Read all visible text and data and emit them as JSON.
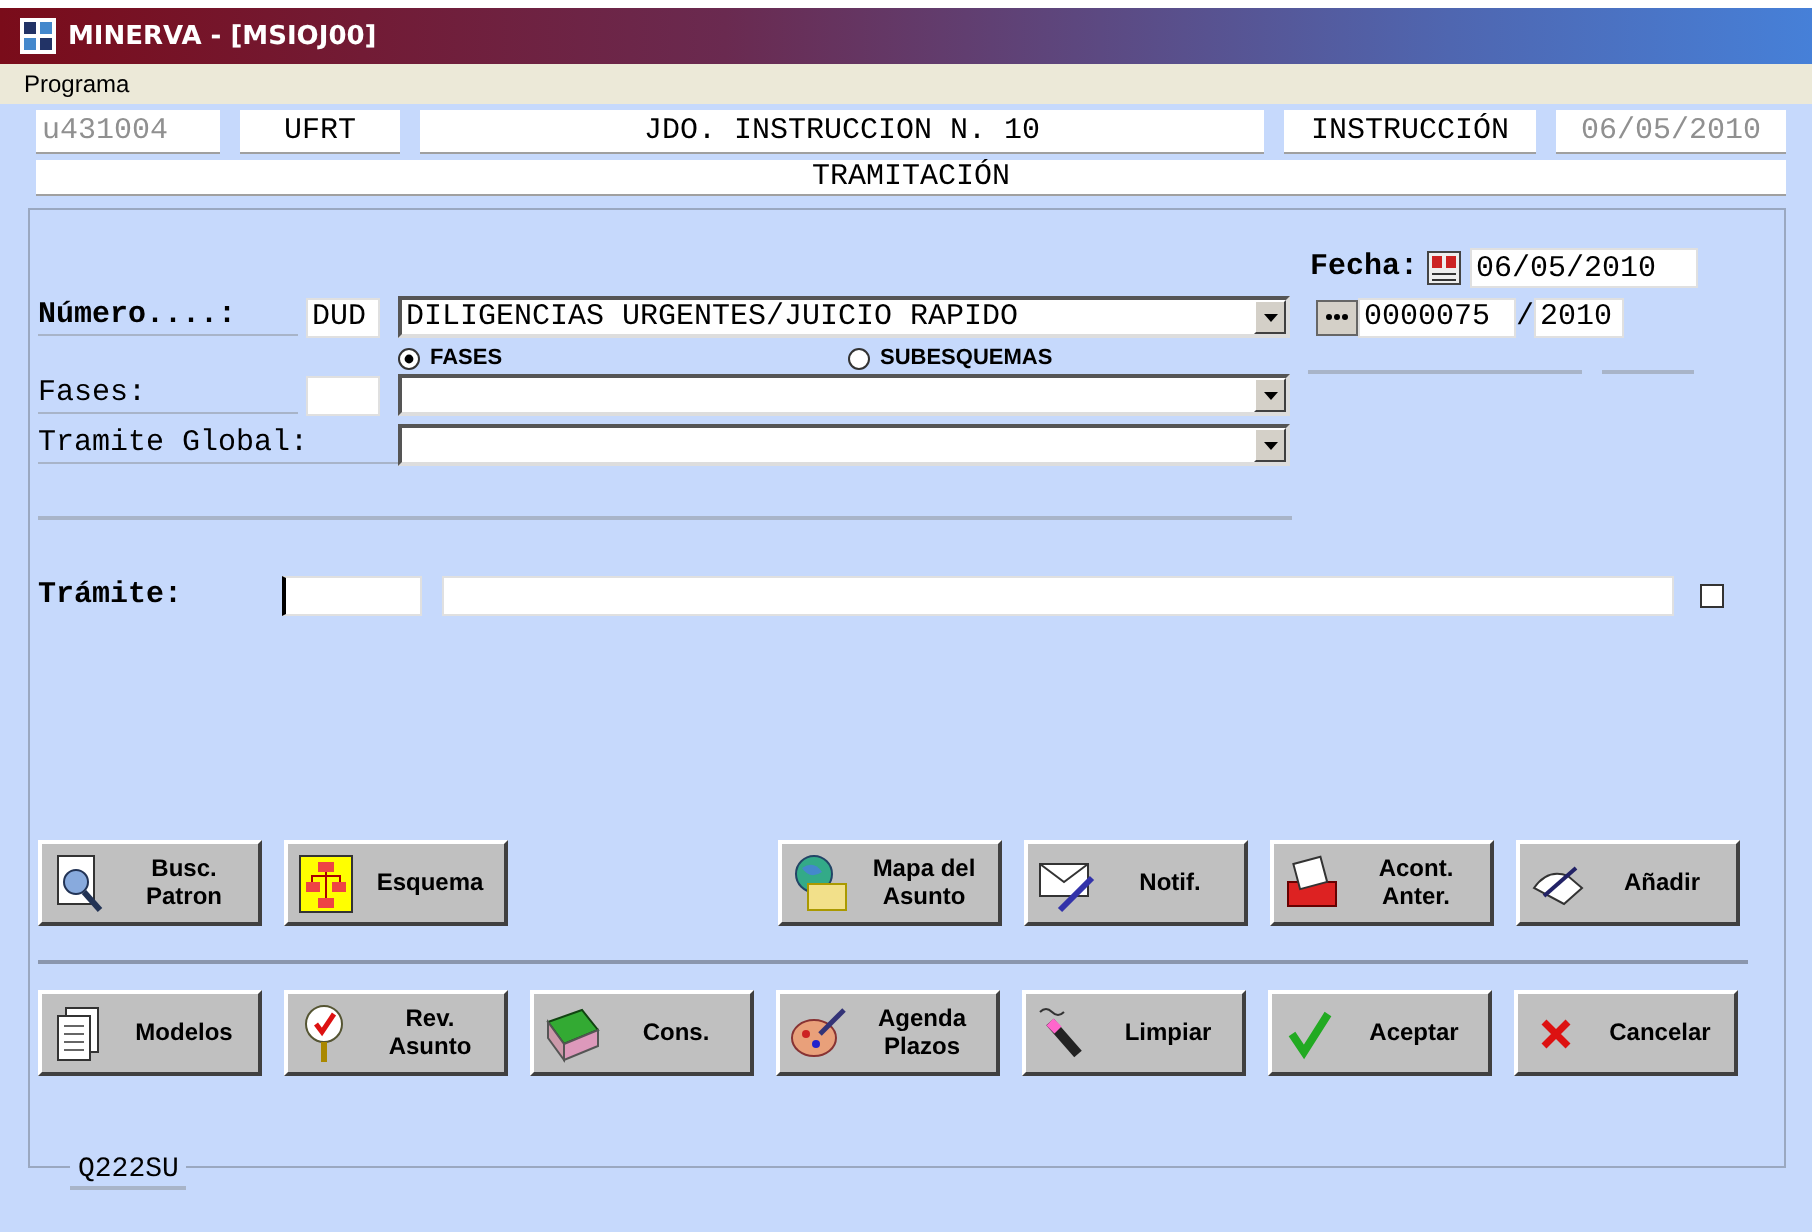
{
  "window": {
    "title": "MINERVA - [MSIOJ00]"
  },
  "menu": [
    "Programa"
  ],
  "header": {
    "user": "u431004",
    "unit": "UFRT",
    "court": "JDO. INSTRUCCION N. 10",
    "type": "INSTRUCCIÓN",
    "date": "06/05/2010",
    "section": "TRAMITACIÓN"
  },
  "form": {
    "fecha": {
      "label": "Fecha:",
      "value": "06/05/2010"
    },
    "numero": {
      "label": "Número....:",
      "code": "DUD",
      "description": "DILIGENCIAS URGENTES/JUICIO RAPIDO",
      "number": "0000075",
      "separator": "/",
      "year": "2010"
    },
    "mode_options": [
      {
        "label": "FASES",
        "selected": true
      },
      {
        "label": "SUBESQUEMAS",
        "selected": false
      }
    ],
    "fases": {
      "label": "Fases:"
    },
    "tramite_global": {
      "label": "Tramite Global:"
    },
    "tramite": {
      "label": "Trámite:",
      "checked": false
    }
  },
  "buttons_row_1": {
    "left": [
      {
        "lines": [
          "Busc.",
          "Patron"
        ]
      },
      {
        "lines": [
          "Esquema"
        ]
      }
    ],
    "right": [
      {
        "lines": [
          "Mapa del",
          "Asunto"
        ]
      },
      {
        "lines": [
          "Notif."
        ]
      },
      {
        "lines": [
          "Acont.",
          "Anter."
        ]
      },
      {
        "lines": [
          "Añadir"
        ]
      }
    ]
  },
  "buttons_row_2": [
    {
      "lines": [
        "Modelos"
      ]
    },
    {
      "lines": [
        "Rev.",
        "Asunto"
      ]
    },
    {
      "lines": [
        "Cons."
      ]
    },
    {
      "lines": [
        "Agenda",
        "Plazos"
      ]
    },
    {
      "lines": [
        "Limpiar"
      ]
    },
    {
      "lines": [
        "Aceptar"
      ]
    },
    {
      "lines": [
        "Cancelar"
      ]
    }
  ],
  "footer_code": "Q222SU"
}
